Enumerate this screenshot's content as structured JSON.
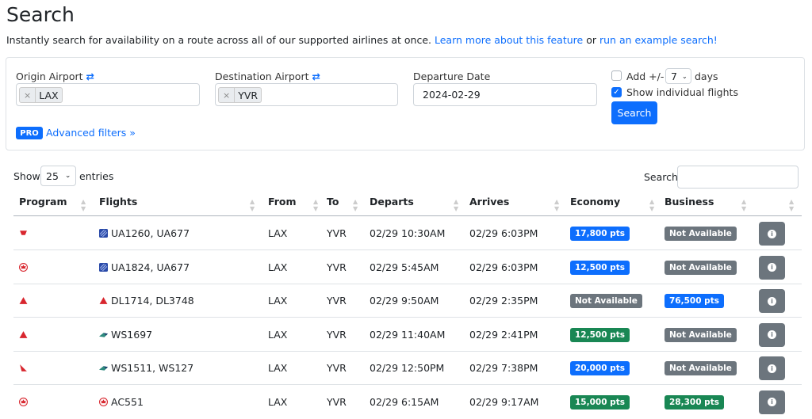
{
  "header": {
    "title": "Search",
    "subtitle": "Instantly search for availability on a route across all of our supported airlines at once.",
    "learn_more": "Learn more about this feature",
    "or": "or",
    "example": "run an example search!"
  },
  "form": {
    "origin_label": "Origin Airport",
    "origin_value": "LAX",
    "dest_label": "Destination Airport",
    "dest_value": "YVR",
    "date_label": "Departure Date",
    "date_value": "2024-02-29",
    "add_days_label": "Add +/-",
    "days_value": "7",
    "days_suffix": "days",
    "show_individual": "Show individual flights",
    "search_button": "Search",
    "pro_badge": "PRO",
    "advanced_filters": "Advanced filters"
  },
  "table_controls": {
    "show": "Show",
    "entries_value": "25",
    "entries": "entries",
    "search_label": "Search:"
  },
  "columns": [
    "Program",
    "Flights",
    "From",
    "To",
    "Departs",
    "Arrives",
    "Economy",
    "Business"
  ],
  "rows": [
    {
      "program": "virgin",
      "flight_icon": "united",
      "flights": "UA1260, UA677",
      "from": "LAX",
      "to": "YVR",
      "departs": "02/29 10:30AM",
      "arrives": "02/29 6:03PM",
      "economy": "17,800 pts",
      "eco_color": "blue",
      "business": "Not Available",
      "bus_color": "gray"
    },
    {
      "program": "aircanada",
      "flight_icon": "united",
      "flights": "UA1824, UA677",
      "from": "LAX",
      "to": "YVR",
      "departs": "02/29 5:45AM",
      "arrives": "02/29 6:03PM",
      "economy": "12,500 pts",
      "eco_color": "blue",
      "business": "Not Available",
      "bus_color": "gray"
    },
    {
      "program": "delta",
      "flight_icon": "delta",
      "flights": "DL1714, DL3748",
      "from": "LAX",
      "to": "YVR",
      "departs": "02/29 9:50AM",
      "arrives": "02/29 2:35PM",
      "economy": "Not Available",
      "eco_color": "gray",
      "business": "76,500 pts",
      "bus_color": "blue"
    },
    {
      "program": "delta",
      "flight_icon": "westjet",
      "flights": "WS1697",
      "from": "LAX",
      "to": "YVR",
      "departs": "02/29 11:40AM",
      "arrives": "02/29 2:41PM",
      "economy": "12,500 pts",
      "eco_color": "green",
      "business": "Not Available",
      "bus_color": "gray"
    },
    {
      "program": "qantas",
      "flight_icon": "westjet",
      "flights": "WS1511, WS127",
      "from": "LAX",
      "to": "YVR",
      "departs": "02/29 12:50PM",
      "arrives": "02/29 7:38PM",
      "economy": "20,000 pts",
      "eco_color": "blue",
      "business": "Not Available",
      "bus_color": "gray"
    },
    {
      "program": "aircanada",
      "flight_icon": "aircanada",
      "flights": "AC551",
      "from": "LAX",
      "to": "YVR",
      "departs": "02/29 6:15AM",
      "arrives": "02/29 9:17AM",
      "economy": "15,000 pts",
      "eco_color": "green",
      "business": "28,300 pts",
      "bus_color": "green"
    }
  ]
}
